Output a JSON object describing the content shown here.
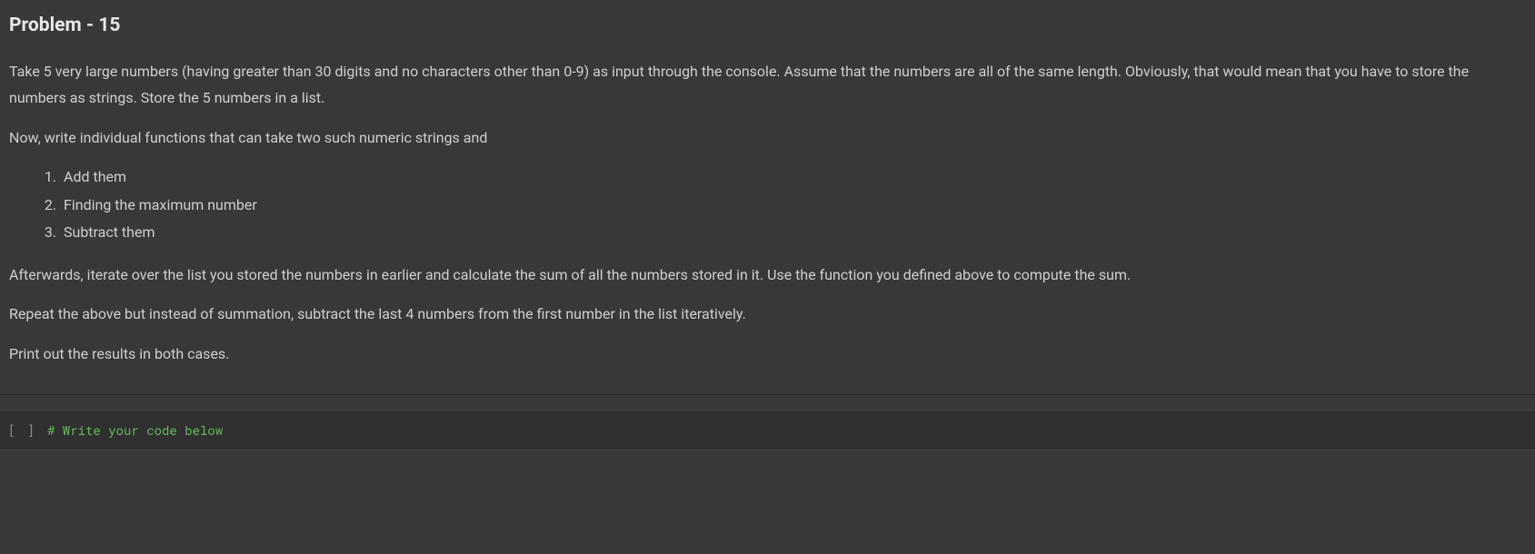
{
  "text_cell": {
    "heading": "Problem - 15",
    "p1": "Take 5 very large numbers (having greater than 30 digits and no characters other than 0-9) as input through the console. Assume that the numbers are all of the same length. Obviously, that would mean that you have to store the numbers as strings. Store the 5 numbers in a list.",
    "p2": "Now, write individual functions that can take two such numeric strings and",
    "list": [
      "Add them",
      "Finding the maximum number",
      "Subtract them"
    ],
    "p3": "Afterwards, iterate over the list you stored the numbers in earlier and calculate the sum of all the numbers stored in it. Use the function you defined above to compute the sum.",
    "p4": "Repeat the above but instead of summation, subtract the last 4 numbers from the first number in the list iteratively.",
    "p5": "Print out the results in both cases."
  },
  "code_cell": {
    "exec_label": "[ ]",
    "comment": "# Write your code below"
  }
}
